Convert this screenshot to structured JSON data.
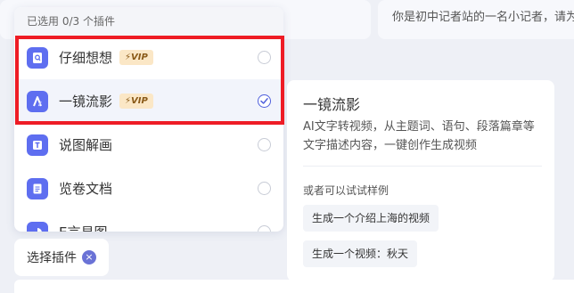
{
  "background": {
    "prompt_text": "你是初中记者站的一名小记者，请为"
  },
  "dropdown": {
    "header": "已选用 0/3 个插件",
    "items": [
      {
        "label": "仔细想想",
        "vip": "⚡VIP",
        "icon": "search-doc-icon",
        "selected": false
      },
      {
        "label": "一镜流影",
        "vip": "⚡VIP",
        "icon": "video-icon",
        "selected": true
      },
      {
        "label": "说图解画",
        "vip": "",
        "icon": "image-text-icon",
        "selected": false
      },
      {
        "label": "览卷文档",
        "vip": "",
        "icon": "document-icon",
        "selected": false
      },
      {
        "label": "E言易图",
        "vip": "",
        "icon": "chart-icon",
        "selected": false
      }
    ]
  },
  "select_tag": {
    "label": "选择插件",
    "close": "×"
  },
  "detail": {
    "title": "一镜流影",
    "description": "AI文字转视频，从主题词、语句、段落篇章等文字描述内容，一键创作生成视频",
    "subtitle": "或者可以试试样例",
    "samples": [
      "生成一个介绍上海的视频",
      "生成一个视频：秋天"
    ]
  },
  "colors": {
    "accent": "#4f5fdc",
    "highlight": "#ee1c25",
    "vip_bg": "#fbe7c6",
    "icon_bg": "#5e6ef0"
  }
}
